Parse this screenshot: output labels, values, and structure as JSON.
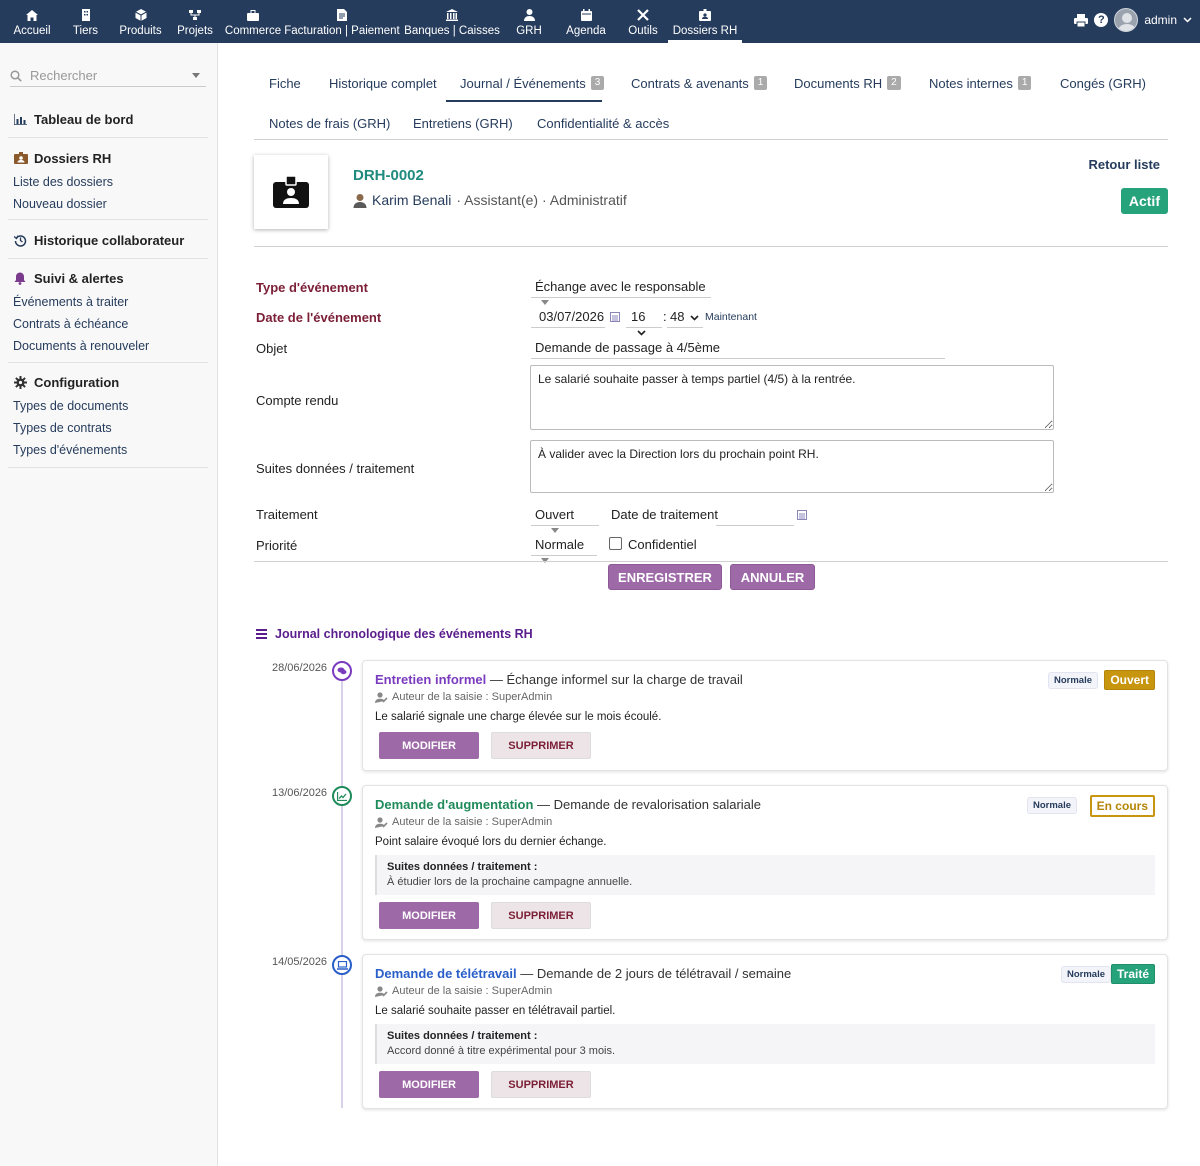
{
  "topbar": {
    "items": [
      {
        "label": "Accueil",
        "icon": "home-icon"
      },
      {
        "label": "Tiers",
        "icon": "building-icon"
      },
      {
        "label": "Produits",
        "icon": "cube-icon"
      },
      {
        "label": "Projets",
        "icon": "sitemap-icon"
      },
      {
        "label": "Commerce",
        "icon": "briefcase-icon"
      },
      {
        "label": "Facturation | Paiement",
        "icon": "invoice-icon"
      },
      {
        "label": "Banques | Caisses",
        "icon": "bank-icon"
      },
      {
        "label": "GRH",
        "icon": "user-tie-icon"
      },
      {
        "label": "Agenda",
        "icon": "calendar-icon"
      },
      {
        "label": "Outils",
        "icon": "tools-icon"
      },
      {
        "label": "Dossiers RH",
        "icon": "id-badge-icon"
      }
    ],
    "user": "admin"
  },
  "sidebar": {
    "search_placeholder": "Rechercher",
    "dashboard": "Tableau de bord",
    "dossiers": {
      "title": "Dossiers RH",
      "items": [
        "Liste des dossiers",
        "Nouveau dossier"
      ]
    },
    "historique": "Historique collaborateur",
    "suivi": {
      "title": "Suivi & alertes",
      "items": [
        "Événements à traiter",
        "Contrats à échéance",
        "Documents à renouveler"
      ]
    },
    "config": {
      "title": "Configuration",
      "items": [
        "Types de documents",
        "Types de contrats",
        "Types d'événements"
      ]
    }
  },
  "tabs": [
    {
      "label": "Fiche"
    },
    {
      "label": "Historique complet"
    },
    {
      "label": "Journal / Événements",
      "badge": "3"
    },
    {
      "label": "Contrats & avenants",
      "badge": "1"
    },
    {
      "label": "Documents RH",
      "badge": "2"
    },
    {
      "label": "Notes internes",
      "badge": "1"
    },
    {
      "label": "Congés (GRH)"
    },
    {
      "label": "Notes de frais (GRH)"
    },
    {
      "label": "Entretiens (GRH)"
    },
    {
      "label": "Confidentialité & accès"
    }
  ],
  "dossier": {
    "ref": "DRH-0002",
    "name": "Karim Benali",
    "info": "· Assistant(e) · Administratif",
    "back": "Retour liste",
    "status": "Actif"
  },
  "form": {
    "type_label": "Type d'événement",
    "type_value": "Échange avec le responsable",
    "date_label": "Date de l'événement",
    "date_value": "03/07/2026",
    "hour": "16",
    "minute": "48",
    "now": "Maintenant",
    "objet_label": "Objet",
    "objet_value": "Demande de passage à 4/5ème",
    "compte_label": "Compte rendu",
    "compte_value": "Le salarié souhaite passer à temps partiel (4/5) à la rentrée.",
    "suites_label": "Suites données / traitement",
    "suites_value": "À valider avec la Direction lors du prochain point RH.",
    "traitement_label": "Traitement",
    "traitement_value": "Ouvert",
    "date_trait_label": "Date de traitement",
    "priorite_label": "Priorité",
    "priorite_value": "Normale",
    "confidentiel_label": "Confidentiel",
    "save": "ENREGISTRER",
    "cancel": "ANNULER"
  },
  "journal": {
    "title": "Journal chronologique des événements RH",
    "author_prefix": "Auteur de la saisie : SuperAdmin",
    "suite_head": "Suites données / traitement :",
    "modify": "MODIFIER",
    "delete": "SUPPRIMER",
    "events": [
      {
        "date": "28/06/2026",
        "type": "Entretien informel",
        "subject": "— Échange informel sur la charge de travail",
        "desc": "Le salarié signale une charge élevée sur le mois écoulé.",
        "priority": "Normale",
        "status": "Ouvert",
        "color": "#7a3bbf",
        "icon": "comments-icon"
      },
      {
        "date": "13/06/2026",
        "type": "Demande d'augmentation",
        "subject": "— Demande de revalorisation salariale",
        "desc": "Point salaire évoqué lors du dernier échange.",
        "suite": "À étudier lors de la prochaine campagne annuelle.",
        "priority": "Normale",
        "status": "En cours",
        "color": "#1f8a5a",
        "icon": "chart-up-icon"
      },
      {
        "date": "14/05/2026",
        "type": "Demande de télétravail",
        "subject": "— Demande de 2 jours de télétravail / semaine",
        "desc": "Le salarié souhaite passer en télétravail partiel.",
        "suite": "Accord donné à titre expérimental pour 3 mois.",
        "priority": "Normale",
        "status": "Traité",
        "color": "#2a5fc9",
        "icon": "laptop-icon"
      }
    ]
  }
}
